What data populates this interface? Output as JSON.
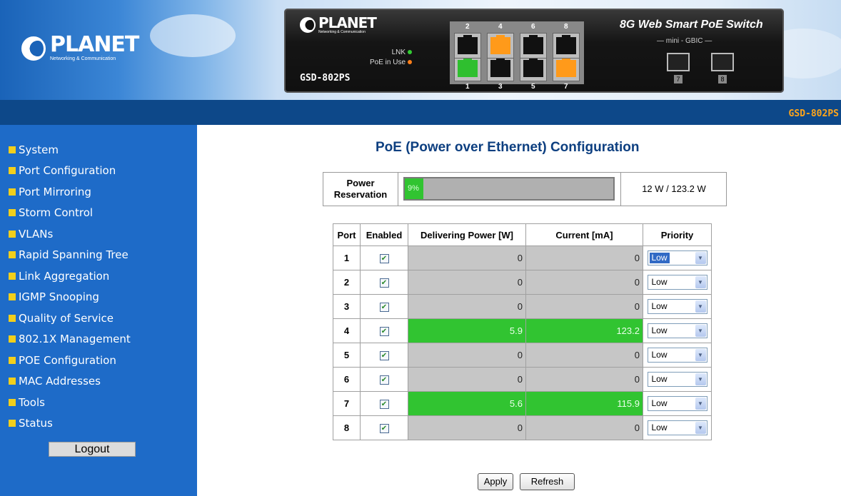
{
  "header": {
    "brand_name": "PLANET",
    "brand_tagline": "Networking & Communication",
    "device": {
      "brand_name": "PLANET",
      "brand_tagline": "Networking & Communication",
      "model": "GSD-802PS",
      "title": "8G Web Smart PoE Switch",
      "gbic_label": "— mini - GBIC —",
      "led_lnk": "LNK",
      "led_poe": "PoE in Use",
      "led_lnk_color": "#33cc33",
      "led_poe_color": "#ff7f1a",
      "ports": [
        {
          "number": "1",
          "color": "#2fbf2f"
        },
        {
          "number": "2",
          "color": "#111111"
        },
        {
          "number": "3",
          "color": "#111111"
        },
        {
          "number": "4",
          "color": "#ff9a1a"
        },
        {
          "number": "5",
          "color": "#111111"
        },
        {
          "number": "6",
          "color": "#111111"
        },
        {
          "number": "7",
          "color": "#ff9a1a"
        },
        {
          "number": "8",
          "color": "#111111"
        }
      ],
      "sfp_ports": [
        "7",
        "8"
      ]
    }
  },
  "bar": {
    "model": "GSD-802PS"
  },
  "sidebar": {
    "items": [
      {
        "label": "System"
      },
      {
        "label": "Port Configuration"
      },
      {
        "label": "Port Mirroring"
      },
      {
        "label": "Storm Control"
      },
      {
        "label": "VLANs"
      },
      {
        "label": "Rapid Spanning Tree"
      },
      {
        "label": "Link Aggregation"
      },
      {
        "label": "IGMP Snooping"
      },
      {
        "label": "Quality of Service"
      },
      {
        "label": "802.1X Management"
      },
      {
        "label": "POE Configuration"
      },
      {
        "label": "MAC Addresses"
      },
      {
        "label": "Tools"
      },
      {
        "label": "Status"
      }
    ],
    "logout_label": "Logout"
  },
  "main": {
    "title": "PoE (Power over Ethernet) Configuration",
    "power_reservation": {
      "label_line1": "Power",
      "label_line2": "Reservation",
      "percent_text": "9%",
      "fraction": 0.09,
      "value": "12 W / 123.2 W"
    },
    "table": {
      "headers": [
        "Port",
        "Enabled",
        "Delivering Power [W]",
        "Current [mA]",
        "Priority"
      ],
      "rows": [
        {
          "port": "1",
          "enabled": true,
          "power": "0",
          "current": "0",
          "priority": "Low",
          "active": false
        },
        {
          "port": "2",
          "enabled": true,
          "power": "0",
          "current": "0",
          "priority": "Low",
          "active": false
        },
        {
          "port": "3",
          "enabled": true,
          "power": "0",
          "current": "0",
          "priority": "Low",
          "active": false
        },
        {
          "port": "4",
          "enabled": true,
          "power": "5.9",
          "current": "123.2",
          "priority": "Low",
          "active": true
        },
        {
          "port": "5",
          "enabled": true,
          "power": "0",
          "current": "0",
          "priority": "Low",
          "active": false
        },
        {
          "port": "6",
          "enabled": true,
          "power": "0",
          "current": "0",
          "priority": "Low",
          "active": false
        },
        {
          "port": "7",
          "enabled": true,
          "power": "5.6",
          "current": "115.9",
          "priority": "Low",
          "active": true
        },
        {
          "port": "8",
          "enabled": true,
          "power": "0",
          "current": "0",
          "priority": "Low",
          "active": false
        }
      ]
    },
    "apply_label": "Apply",
    "refresh_label": "Refresh"
  }
}
